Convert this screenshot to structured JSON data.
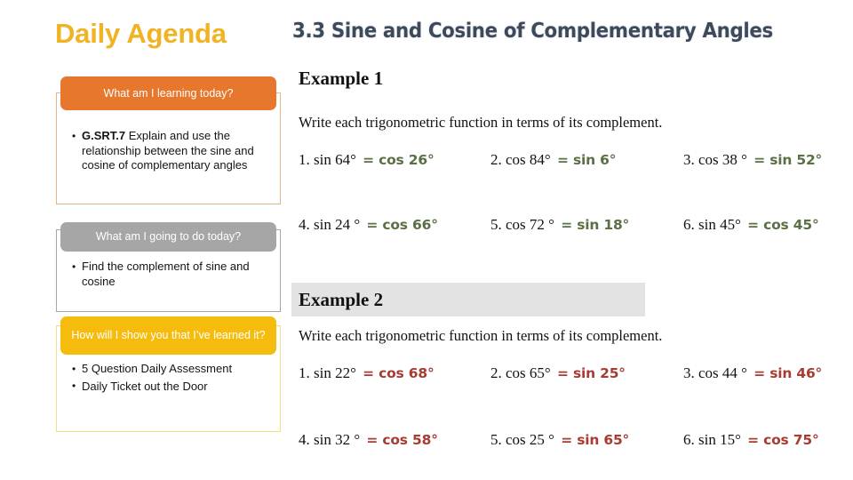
{
  "slide": {
    "agenda_title": "Daily Agenda",
    "lesson_title": "3.3 Sine and Cosine of Complementary Angles"
  },
  "agenda": {
    "sections": [
      {
        "badge": "What am I learning today?",
        "badge_color": "#e8772e",
        "border_color": "#e2b88a",
        "bullets": [
          {
            "code": "G.SRT.7",
            "text": " Explain and use the relationship between the sine and cosine of complementary angles"
          }
        ]
      },
      {
        "badge": "What am I going to do today?",
        "badge_color": "#a6a6a6",
        "border_color": "#a6a6a6",
        "bullets": [
          {
            "code": "",
            "text": "Find the complement of sine and cosine"
          }
        ]
      },
      {
        "badge": "How will I show you that I’ve learned it?",
        "badge_color": "#f5bc0e",
        "border_color": "#f2e07a",
        "bullets": [
          {
            "code": "",
            "text": "5 Question Daily Assessment"
          },
          {
            "code": "",
            "text": "Daily Ticket out the Door"
          }
        ]
      }
    ]
  },
  "examples": [
    {
      "heading": "Example 1",
      "prompt": "Write each trigonometric function in terms of its complement.",
      "answer_color": "#5b7045",
      "rows": [
        [
          {
            "number": "1.",
            "question": "sin 64°",
            "answer": "= cos 26°"
          },
          {
            "number": "2.",
            "question": "cos 84°",
            "answer": "= sin 6°"
          },
          {
            "number": "3.",
            "question": "cos 38 °",
            "answer": "= sin 52°"
          }
        ],
        [
          {
            "number": "4.",
            "question": "sin 24 °",
            "answer": "= cos 66°"
          },
          {
            "number": "5.",
            "question": "cos 72 °",
            "answer": "= sin 18°"
          },
          {
            "number": "6.",
            "question": "sin 45°",
            "answer": "= cos 45°"
          }
        ]
      ]
    },
    {
      "heading": "Example 2",
      "prompt": "Write each trigonometric function in terms of its complement.",
      "answer_color": "#a83c32",
      "rows": [
        [
          {
            "number": "1.",
            "question": "sin 22°",
            "answer": "= cos 68°"
          },
          {
            "number": "2.",
            "question": "cos 65°",
            "answer": "= sin 25°"
          },
          {
            "number": "3.",
            "question": "cos 44 °",
            "answer": "= sin 46°"
          }
        ],
        [
          {
            "number": "4.",
            "question": "sin 32 °",
            "answer": "= cos 58°"
          },
          {
            "number": "5.",
            "question": "cos 25 °",
            "answer": "= sin 65°"
          },
          {
            "number": "6.",
            "question": "sin 15°",
            "answer": "= cos 75°"
          }
        ]
      ]
    }
  ]
}
